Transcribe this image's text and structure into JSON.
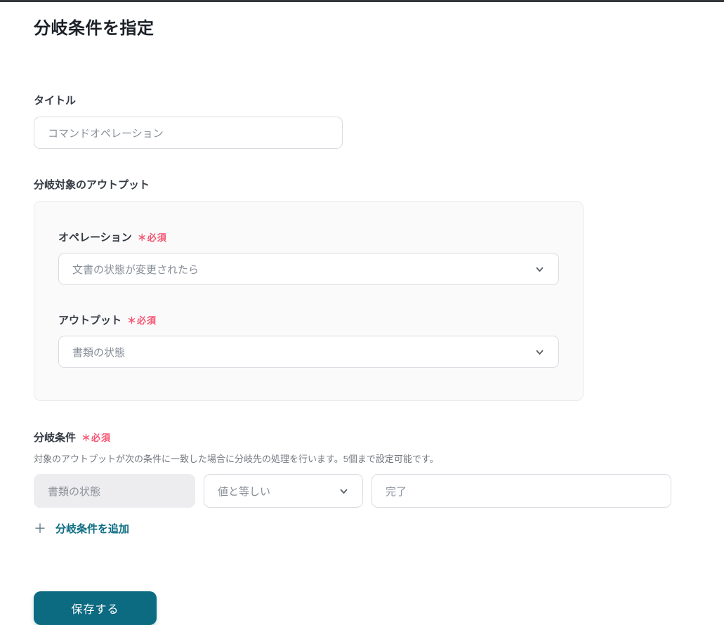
{
  "page": {
    "title": "分岐条件を指定"
  },
  "colors": {
    "accent_teal": "#0c6a81",
    "required_red": "#f5536f",
    "card_background": "#fafafb",
    "muted_text": "#8a919b"
  },
  "form": {
    "title_field": {
      "label": "タイトル",
      "value": "コマンドオペレーション"
    },
    "output_section": {
      "label": "分岐対象のアウトプット",
      "operation": {
        "label": "オペレーション",
        "required": "＊必須",
        "selected_value": "文書の状態が変更されたら",
        "icon": "chevron-down-icon"
      },
      "output": {
        "label": "アウトプット",
        "required": "＊必須",
        "selected_value": "書類の状態",
        "icon": "chevron-down-icon"
      }
    },
    "condition_section": {
      "label": "分岐条件",
      "required": "＊必須",
      "description": "対象のアウトプットが次の条件に一致した場合に分岐先の処理を行います。5個まで設定可能です。",
      "condition_row": {
        "target_value": "書類の状態",
        "operator_value": "値と等しい",
        "comparison_value": "完了"
      },
      "add_link": {
        "icon": "＋",
        "label": "分岐条件を追加"
      }
    },
    "save_button_label": "保存する"
  }
}
